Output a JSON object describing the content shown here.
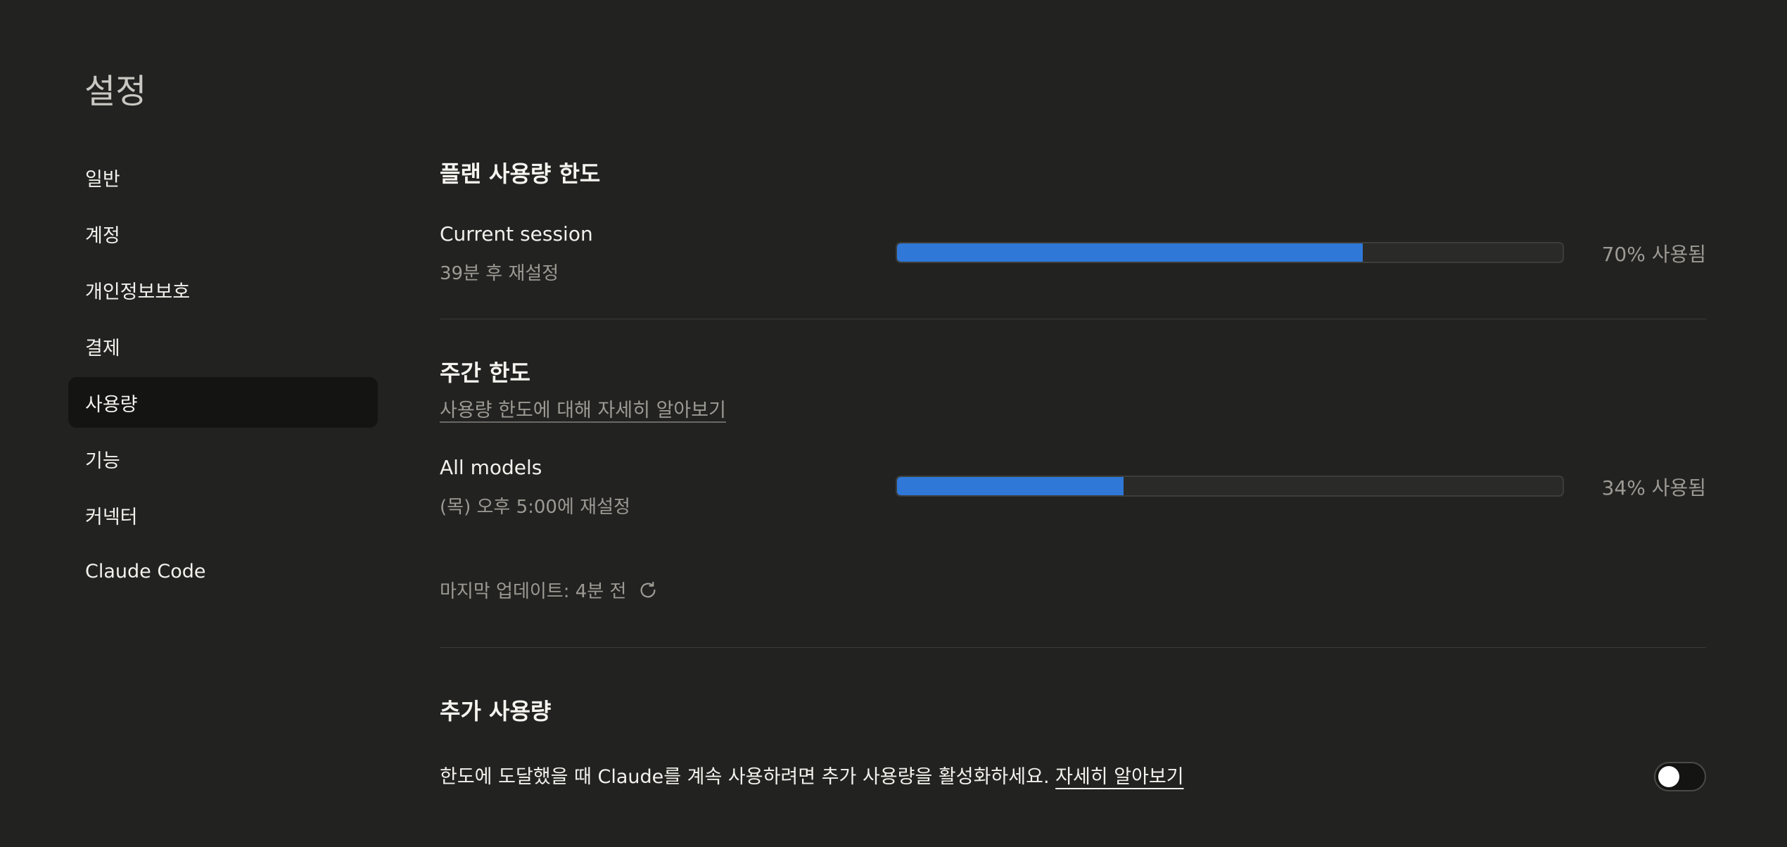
{
  "page": {
    "title": "설정"
  },
  "sidebar": {
    "items": [
      {
        "label": "일반"
      },
      {
        "label": "계정"
      },
      {
        "label": "개인정보보호"
      },
      {
        "label": "결제"
      },
      {
        "label": "사용량",
        "active": true
      },
      {
        "label": "기능"
      },
      {
        "label": "커넥터"
      },
      {
        "label": "Claude Code"
      }
    ]
  },
  "plan_usage": {
    "title": "플랜 사용량 한도",
    "current_session": {
      "label": "Current session",
      "reset": "39분 후 재설정",
      "percent": 70,
      "percent_text": "70% 사용됨"
    }
  },
  "weekly": {
    "title": "주간 한도",
    "learn_more": "사용량 한도에 대해 자세히 알아보기",
    "all_models": {
      "label": "All models",
      "reset": "(목) 오후 5:00에 재설정",
      "percent": 34,
      "percent_text": "34% 사용됨"
    },
    "last_updated": "마지막 업데이트: 4분 전"
  },
  "extra_usage": {
    "title": "추가 사용량",
    "description": "한도에 도달했을 때 Claude를 계속 사용하려면 추가 사용량을 활성화하세요.",
    "link": "자세히 알아보기",
    "enabled": false
  },
  "colors": {
    "background": "#222221",
    "accent_bar": "#2f78d8"
  },
  "icons": {
    "refresh": "refresh-icon"
  }
}
